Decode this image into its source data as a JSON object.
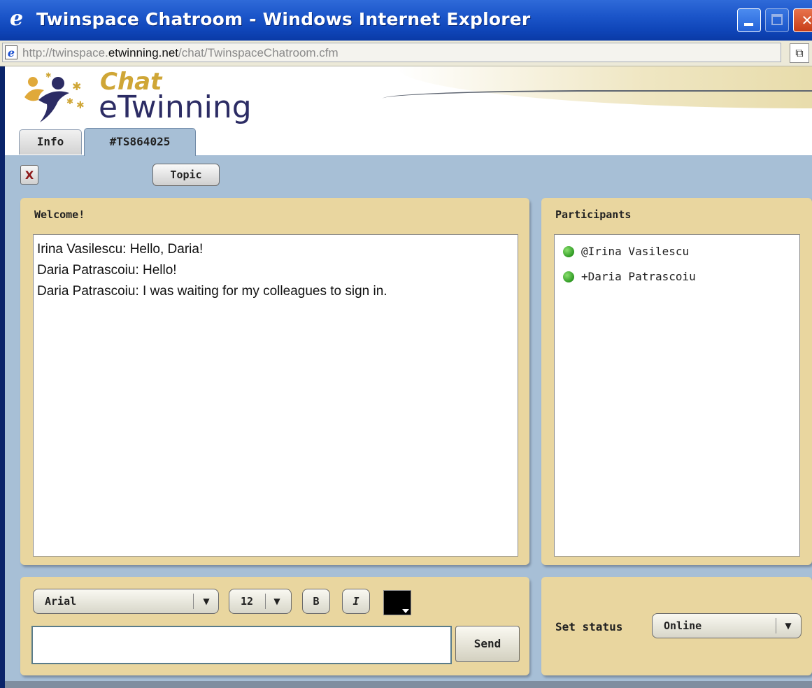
{
  "window": {
    "title": "Twinspace Chatroom - Windows Internet Explorer",
    "url_prefix": "http://twinspace.",
    "url_domain": "etwinning.net",
    "url_path": "/chat/TwinspaceChatroom.cfm"
  },
  "header": {
    "logo_chat": "Chat",
    "logo_etwinning": "eTwinning"
  },
  "tabs": [
    {
      "label": "Info"
    },
    {
      "label": "#TS864025"
    }
  ],
  "toolbar": {
    "close_label": "X",
    "topic_label": "Topic"
  },
  "chat": {
    "title": "Welcome!",
    "messages": [
      "Irina Vasilescu: Hello, Daria!",
      "Daria Patrascoiu: Hello!",
      "Daria Patrascoiu: I was waiting for my colleagues to sign in."
    ]
  },
  "participants": {
    "title": "Participants",
    "list": [
      {
        "name": "@Irina Vasilescu",
        "status_color": "#3a9c2a"
      },
      {
        "name": "+Daria Patrascoiu",
        "status_color": "#3a9c2a"
      }
    ]
  },
  "compose": {
    "font": "Arial",
    "size": "12",
    "bold_label": "B",
    "italic_label": "I",
    "text_color": "#000000",
    "input_value": "",
    "send_label": "Send"
  },
  "status": {
    "label": "Set status",
    "value": "Online"
  },
  "colors": {
    "titlebar": "#1b55c9",
    "content_bg": "#a7bfd6",
    "panel_bg": "#e9d69f",
    "logo_gold": "#cfa636",
    "logo_navy": "#2c2c64"
  },
  "icons": {
    "browser": "ie-logo-icon",
    "page": "ie-page-icon",
    "dropdown": "chevron-down-icon",
    "online": "green-dot-icon"
  }
}
